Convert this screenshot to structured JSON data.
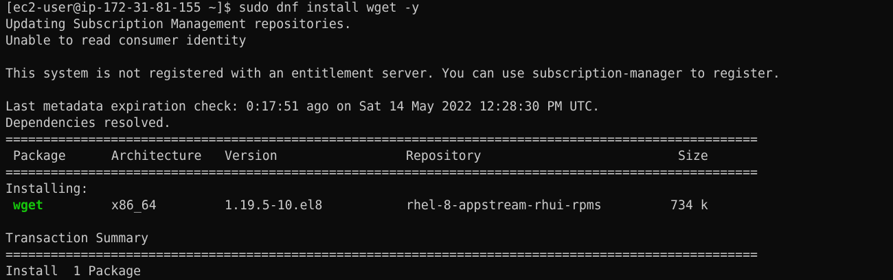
{
  "terminal": {
    "prompt": "[ec2-user@ip-172-31-81-155 ~]$ ",
    "command": "sudo dnf install wget -y",
    "lines": {
      "updating": "Updating Subscription Management repositories.",
      "unable": "Unable to read consumer identity",
      "not_registered": "This system is not registered with an entitlement server. You can use subscription-manager to register.",
      "metadata": "Last metadata expiration check: 0:17:51 ago on Sat 14 May 2022 12:28:30 PM UTC.",
      "deps": "Dependencies resolved.",
      "separator": "====================================================================================================",
      "installing": "Installing:",
      "transaction_summary": "Transaction Summary",
      "install_count": "Install  1 Package"
    },
    "table": {
      "headers": {
        "package": "Package",
        "architecture": "Architecture",
        "version": "Version",
        "repository": "Repository",
        "size": "Size"
      },
      "rows": [
        {
          "package": "wget",
          "architecture": "x86_64",
          "version": "1.19.5-10.el8",
          "repository": "rhel-8-appstream-rhui-rpms",
          "size": "734 k"
        }
      ]
    },
    "colors": {
      "background": "#0c0c0c",
      "text": "#cccccc",
      "package_highlight": "#16c60c"
    }
  }
}
